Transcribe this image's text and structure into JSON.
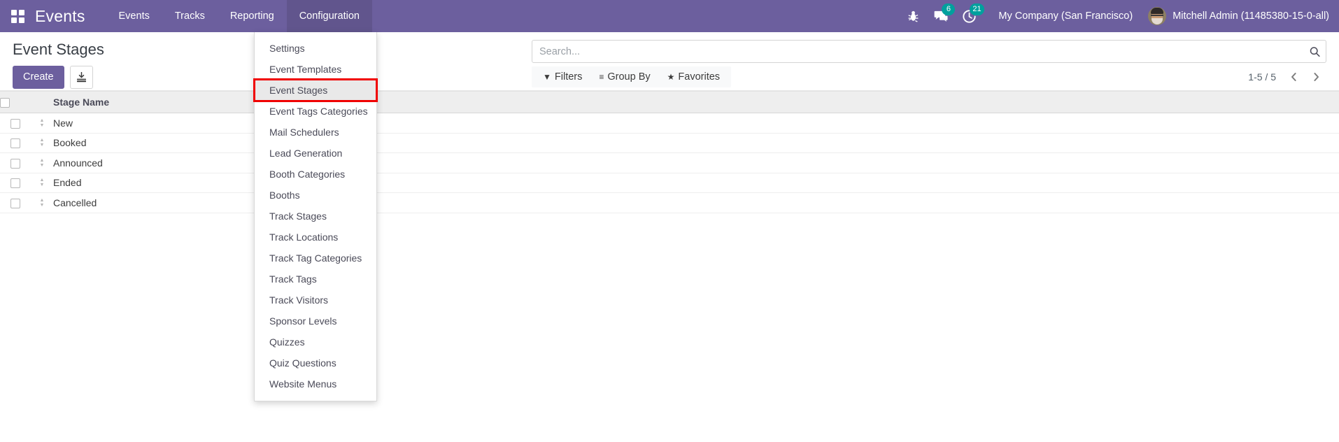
{
  "navbar": {
    "apps_icon": "grid-apps-icon",
    "brand": "Events",
    "menu": [
      {
        "label": "Events",
        "active": false
      },
      {
        "label": "Tracks",
        "active": false
      },
      {
        "label": "Reporting",
        "active": false
      },
      {
        "label": "Configuration",
        "active": true
      }
    ],
    "sysicons": [
      {
        "name": "bug-icon",
        "badge": ""
      },
      {
        "name": "messages-icon",
        "badge": "6"
      },
      {
        "name": "activities-clock-icon",
        "badge": "21"
      }
    ],
    "company": "My Company (San Francisco)",
    "user": "Mitchell Admin (11485380-15-0-all)",
    "accent": "#6C5F9E",
    "badge_color": "#00A09D"
  },
  "dropdown": {
    "open_for": "Configuration",
    "highlight_color": "#f00000",
    "items": [
      {
        "label": "Settings",
        "state": ""
      },
      {
        "label": "Event Templates",
        "state": ""
      },
      {
        "label": "Event Stages",
        "state": "hilite"
      },
      {
        "label": "Event Tags Categories",
        "state": ""
      },
      {
        "label": "Mail Schedulers",
        "state": ""
      },
      {
        "label": "Lead Generation",
        "state": ""
      },
      {
        "label": "Booth Categories",
        "state": ""
      },
      {
        "label": "Booths",
        "state": ""
      },
      {
        "label": "Track Stages",
        "state": ""
      },
      {
        "label": "Track Locations",
        "state": ""
      },
      {
        "label": "Track Tag Categories",
        "state": ""
      },
      {
        "label": "Track Tags",
        "state": ""
      },
      {
        "label": "Track Visitors",
        "state": ""
      },
      {
        "label": "Sponsor Levels",
        "state": ""
      },
      {
        "label": "Quizzes",
        "state": ""
      },
      {
        "label": "Quiz Questions",
        "state": ""
      },
      {
        "label": "Website Menus",
        "state": ""
      }
    ]
  },
  "control_panel": {
    "page_title": "Event Stages",
    "create_label": "Create",
    "import_icon": "import-download-icon",
    "search": {
      "value": "",
      "placeholder": "Search..."
    },
    "search_icon": "search-icon",
    "filters": [
      {
        "label": "Filters",
        "icon": "funnel-icon",
        "glyph": "▼"
      },
      {
        "label": "Group By",
        "icon": "lines-icon",
        "glyph": "≡"
      },
      {
        "label": "Favorites",
        "icon": "star-icon",
        "glyph": "★"
      }
    ],
    "pager": {
      "range": "1-5 / 5",
      "prev_icon": "chevron-left-icon",
      "next_icon": "chevron-right-icon"
    }
  },
  "list": {
    "columns": [
      "Stage Name"
    ],
    "select_all_icon": "checkbox-select-all",
    "rows": [
      {
        "stage_name": "New"
      },
      {
        "stage_name": "Booked"
      },
      {
        "stage_name": "Announced"
      },
      {
        "stage_name": "Ended"
      },
      {
        "stage_name": "Cancelled"
      }
    ]
  }
}
